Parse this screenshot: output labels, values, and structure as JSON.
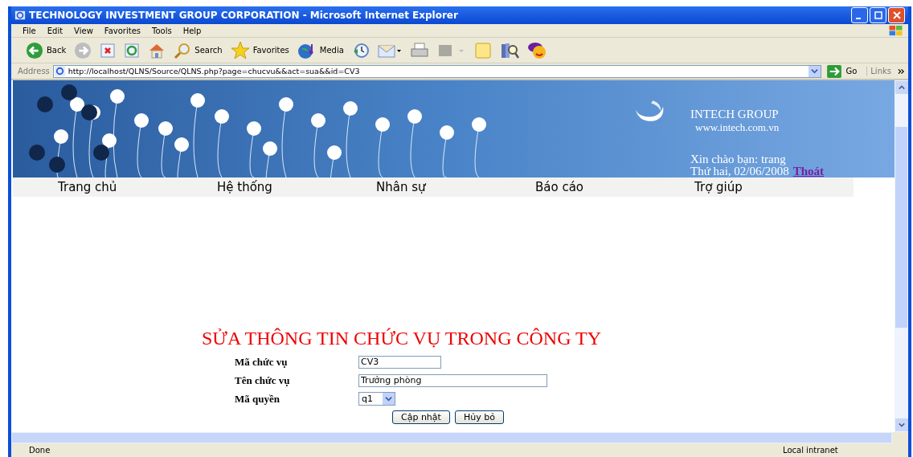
{
  "window": {
    "title": "TECHNOLOGY INVESTMENT GROUP CORPORATION - Microsoft Internet Explorer"
  },
  "menu": [
    "File",
    "Edit",
    "View",
    "Favorites",
    "Tools",
    "Help"
  ],
  "toolbar": [
    {
      "kind": "back",
      "label": "Back"
    },
    {
      "kind": "forward"
    },
    {
      "kind": "stop"
    },
    {
      "kind": "refresh"
    },
    {
      "kind": "home"
    },
    {
      "kind": "search",
      "label": "Search"
    },
    {
      "kind": "favorites",
      "label": "Favorites"
    },
    {
      "kind": "media",
      "label": "Media"
    },
    {
      "kind": "history"
    },
    {
      "kind": "mail"
    },
    {
      "kind": "print"
    },
    {
      "kind": "edit"
    },
    {
      "kind": "note"
    },
    {
      "kind": "research"
    },
    {
      "kind": "messenger"
    }
  ],
  "address": {
    "label": "Address",
    "url": "http://localhost/QLNS/Source/QLNS.php?page=chucvu&&act=sua&&id=CV3",
    "go": "Go",
    "links": "Links"
  },
  "header": {
    "company": "INTECH GROUP",
    "website": "www.intech.com.vn",
    "greeting": "Xin chào bạn: trang",
    "date": "Thứ hai, 02/06/2008",
    "logout": "Thoát"
  },
  "nav": [
    "Trang chủ",
    "Hệ thống",
    "Nhân sự",
    "Báo cáo",
    "Trợ giúp"
  ],
  "form": {
    "title": "SỬA THÔNG TIN CHỨC VỤ TRONG CÔNG TY",
    "fields": [
      {
        "kind": "text",
        "label": "Mã chức vụ",
        "value": "CV3"
      },
      {
        "kind": "wide",
        "label": "Tên chức vụ",
        "value": "Trưởng phòng"
      },
      {
        "kind": "select",
        "label": "Mã quyền",
        "value": "q1"
      }
    ],
    "buttons": [
      "Cập nhật",
      "Hủy bỏ"
    ]
  },
  "status_bar": {
    "text": "Done",
    "zone": "Local intranet"
  }
}
